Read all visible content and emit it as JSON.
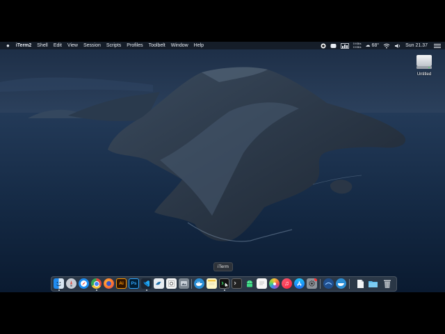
{
  "menubar": {
    "apple_icon": "apple-logo-icon",
    "app_name": "iTerm2",
    "menus": [
      "Shell",
      "Edit",
      "View",
      "Session",
      "Scripts",
      "Profiles",
      "Toolbelt",
      "Window",
      "Help"
    ],
    "status": {
      "network_up": "0 KB/s",
      "network_down": "0 KB/s",
      "temperature": "68°",
      "clock": "Sun 21.37"
    }
  },
  "desktop": {
    "drive_icon": "external-drive-icon",
    "drive_label": "Untitled"
  },
  "dock": {
    "tooltip": "iTerm",
    "apps": [
      {
        "name": "finder",
        "icon": "finder-icon"
      },
      {
        "name": "launchpad",
        "icon": "launchpad-icon"
      },
      {
        "name": "safari",
        "icon": "safari-icon"
      },
      {
        "name": "chrome",
        "icon": "chrome-icon"
      },
      {
        "name": "firefox",
        "icon": "firefox-icon"
      },
      {
        "name": "illustrator",
        "icon": "illustrator-icon",
        "text": "Ai"
      },
      {
        "name": "photoshop",
        "icon": "photoshop-icon",
        "text": "Ps"
      },
      {
        "name": "vscode",
        "icon": "vscode-icon"
      },
      {
        "name": "mysql-workbench",
        "icon": "dolphin-icon"
      },
      {
        "name": "preview",
        "icon": "preview-icon"
      },
      {
        "name": "image-app",
        "icon": "image-app-icon"
      },
      {
        "name": "docker",
        "icon": "docker-whale-icon"
      },
      {
        "name": "notes",
        "icon": "notes-icon"
      },
      {
        "name": "iterm",
        "icon": "iterm-icon"
      },
      {
        "name": "terminal",
        "icon": "terminal-icon"
      },
      {
        "name": "android-studio",
        "icon": "android-icon"
      },
      {
        "name": "textedit",
        "icon": "textedit-icon"
      },
      {
        "name": "photos",
        "icon": "photos-icon"
      },
      {
        "name": "music",
        "icon": "music-icon"
      },
      {
        "name": "app-store",
        "icon": "app-store-icon"
      },
      {
        "name": "system-preferences",
        "icon": "gear-icon"
      },
      {
        "name": "downloads-app",
        "icon": "download-icon"
      },
      {
        "name": "docker-desktop",
        "icon": "docker-icon"
      },
      {
        "name": "documents",
        "icon": "document-icon"
      },
      {
        "name": "folder",
        "icon": "folder-icon"
      },
      {
        "name": "trash",
        "icon": "trash-icon"
      }
    ]
  }
}
